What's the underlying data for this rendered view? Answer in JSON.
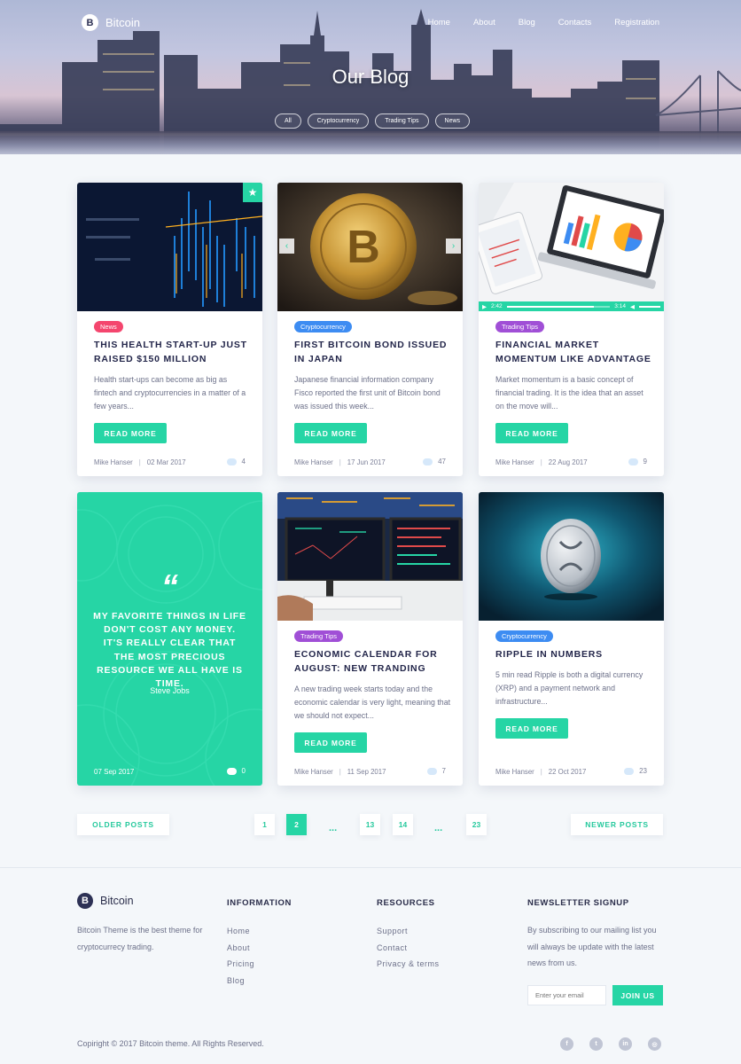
{
  "brand": {
    "name": "Bitcoin",
    "logo_letter": "B"
  },
  "nav": [
    "Home",
    "About",
    "Blog",
    "Contacts",
    "Registration"
  ],
  "hero": {
    "title": "Our Blog",
    "filters": [
      "All",
      "Cryptocurrency",
      "Trading Tips",
      "News"
    ]
  },
  "posts": [
    {
      "tag": "News",
      "tag_color": "#f4466e",
      "title": "This health start-up just raised $150 million",
      "excerpt": "Health start-ups can become as big as fintech and cryptocurrencies in a matter of a few years...",
      "button": "READ MORE",
      "author": "Mike Hanser",
      "date": "02 Mar 2017",
      "comments": "4"
    },
    {
      "tag": "Cryptocurrency",
      "tag_color": "#3d8cf2",
      "title": "First Bitcoin bond issued in Japan",
      "excerpt": "Japanese financial information company Fisco reported the first unit of Bitcoin bond was issued this week...",
      "button": "READ MORE",
      "author": "Mike Hanser",
      "date": "17 Jun 2017",
      "comments": "47"
    },
    {
      "tag": "Trading Tips",
      "tag_color": "#a04fd6",
      "title": "Financial market momentum like advantage",
      "excerpt": "Market momentum is a basic concept of financial trading. It is the idea that an asset on the move will...",
      "button": "READ MORE",
      "author": "Mike Hanser",
      "date": "22 Aug 2017",
      "comments": "9",
      "video": {
        "current": "2:42",
        "total": "3:14",
        "progress": 0.84
      }
    },
    {
      "tag": "Trading Tips",
      "tag_color": "#a04fd6",
      "title": "Economic calendar for August: new tranding",
      "excerpt": "A new trading week starts today and the economic calendar is very light, meaning that we should not expect...",
      "button": "READ MORE",
      "author": "Mike Hanser",
      "date": "11 Sep 2017",
      "comments": "7"
    },
    {
      "tag": "Cryptocurrency",
      "tag_color": "#3d8cf2",
      "title": "Ripple in numbers",
      "excerpt": "5 min read Ripple is both a digital currency (XRP) and a payment network and infrastructure...",
      "button": "READ MORE",
      "author": "Mike Hanser",
      "date": "22 Oct 2017",
      "comments": "23"
    }
  ],
  "quote": {
    "mark": "“",
    "text": "My favorite things in life don't cost any money. It's really clear that the most precious resource we all have is time.",
    "author": "Steve Jobs",
    "date": "07 Sep 2017",
    "comments": "0"
  },
  "pagination": {
    "older": "OLDER POSTS",
    "newer": "NEWER POSTS",
    "pages": [
      "1",
      "2",
      "13",
      "14",
      "23"
    ],
    "dots": "...",
    "active": "2"
  },
  "footer": {
    "brand": "Bitcoin",
    "description": "Bitcoin Theme is the best theme for cryptocurrecy trading.",
    "information": {
      "heading": "INFORMATION",
      "links": [
        "Home",
        "About",
        "Pricing",
        "Blog"
      ]
    },
    "resources": {
      "heading": "RESOURCES",
      "links": [
        "Support",
        "Contact",
        "Privacy & terms"
      ]
    },
    "newsletter": {
      "heading": "NEWSLETTER SIGNUP",
      "text": "By subscribing to our mailing list you will always be update with the latest news from us.",
      "placeholder": "Enter your email",
      "button": "JOIN US"
    },
    "copyright": "Copiright © 2017 Bitcoin theme. All Rights Reserved.",
    "socials": [
      "facebook-icon",
      "twitter-icon",
      "linkedin-icon",
      "instagram-icon"
    ]
  },
  "colors": {
    "accent": "#26d5a5",
    "dark": "#23264a"
  }
}
